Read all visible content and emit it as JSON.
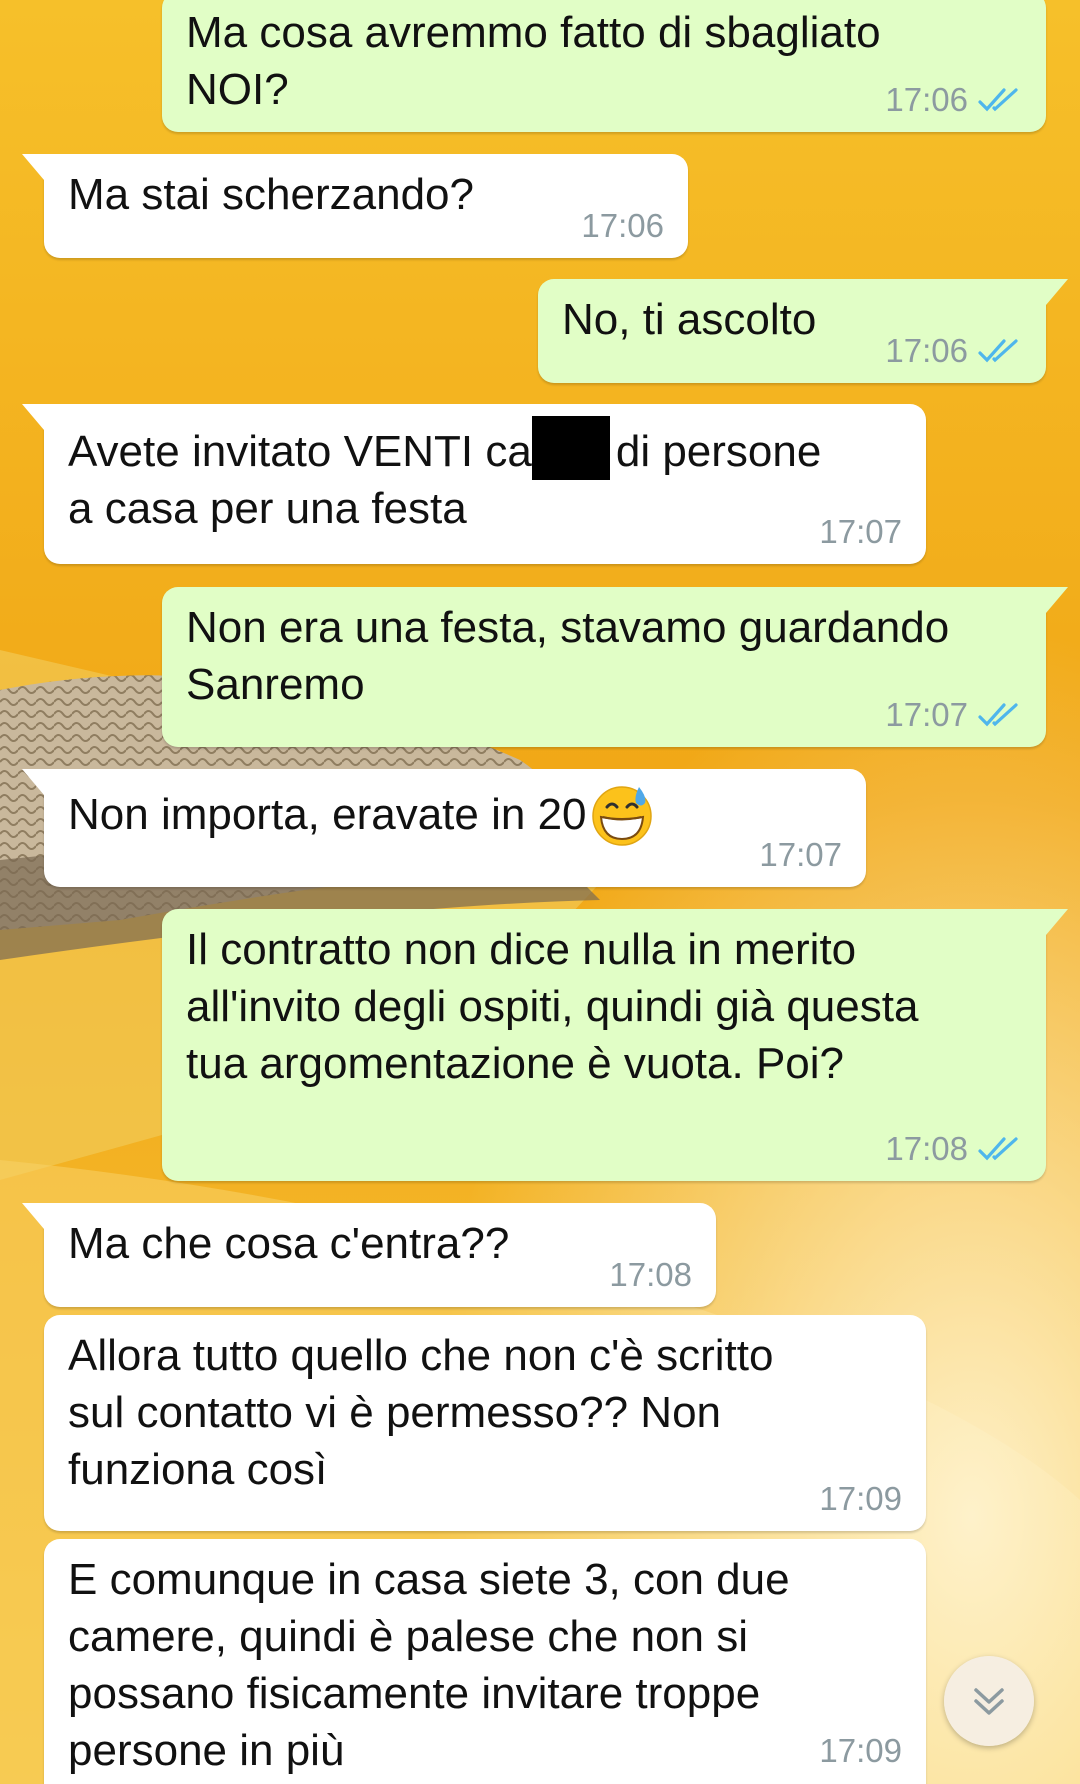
{
  "messages": [
    {
      "direction": "out",
      "text": "Ma cosa avremmo fatto di sbagliato\nNOI?",
      "time": "17:06",
      "read": true
    },
    {
      "direction": "in",
      "text": "Ma stai scherzando?",
      "time": "17:06"
    },
    {
      "direction": "out",
      "text": "No, ti ascolto",
      "time": "17:06",
      "read": true
    },
    {
      "direction": "in",
      "text_before_redaction": "Avete invitato VENTI ca",
      "text_after_redaction": "di persone",
      "text_line2": "a casa per una festa",
      "time": "17:07"
    },
    {
      "direction": "out",
      "text": "Non era una festa, stavamo guardando\nSanremo",
      "time": "17:07",
      "read": true
    },
    {
      "direction": "in",
      "text": "Non importa, eravate in 20",
      "emoji": "grinning-face-with-sweat",
      "time": "17:07"
    },
    {
      "direction": "out",
      "text": "Il contratto non dice nulla in merito\nall'invito degli ospiti, quindi già questa\ntua argomentazione è vuota. Poi?",
      "time": "17:08",
      "read": true
    },
    {
      "direction": "in",
      "text": "Ma che cosa c'entra??",
      "time": "17:08"
    },
    {
      "direction": "in",
      "text": "Allora tutto quello che non c'è scritto\nsul contatto vi è permesso?? Non\nfunziona così",
      "time": "17:09"
    },
    {
      "direction": "in",
      "text": "E comunque in casa siete 3, con due\ncamere, quindi è palese che non si\npossano fisicamente invitare troppe\npersone in più",
      "time": "17:09"
    }
  ],
  "colors": {
    "incoming_bubble": "#ffffff",
    "outgoing_bubble": "#e1fec6",
    "timestamp": "#8c9aa0",
    "read_ticks": "#4fb6ec",
    "wallpaper_primary": "#f3b21c"
  },
  "icons": {
    "read_receipt": "double-check-icon",
    "scroll_down": "double-chevron-down-icon"
  }
}
